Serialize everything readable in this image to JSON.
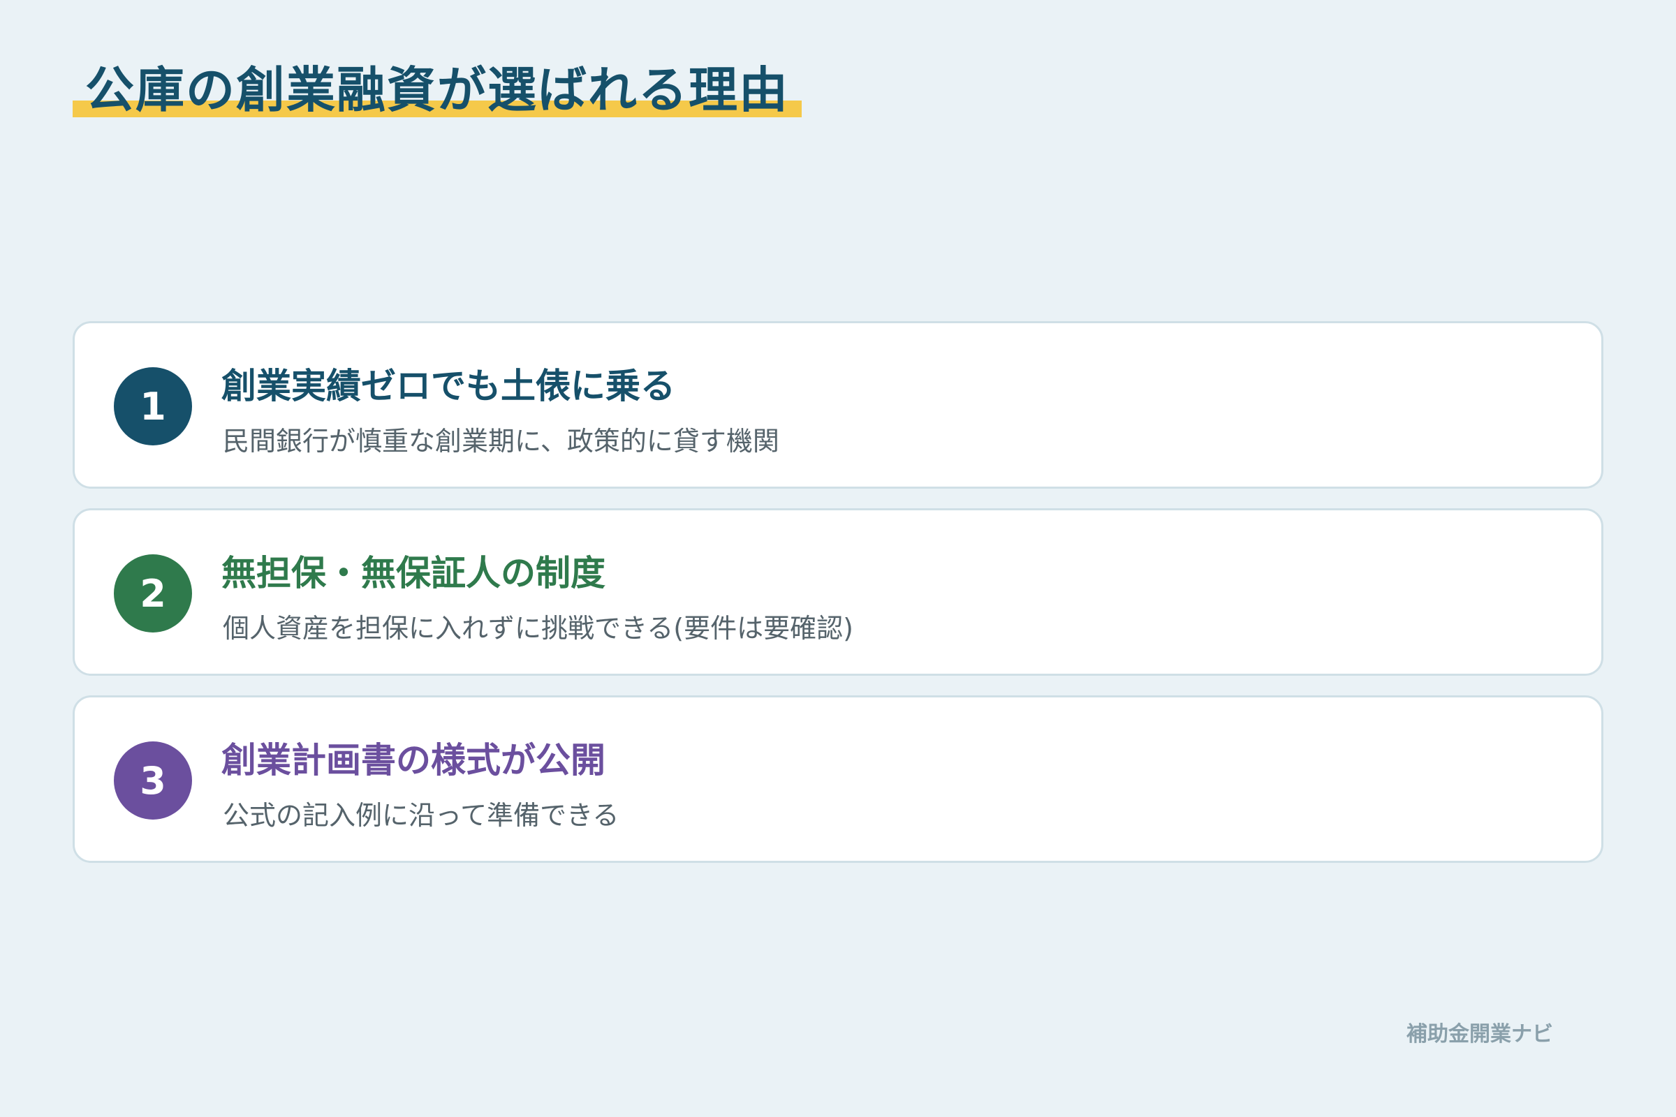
{
  "title": "公庫の創業融資が選ばれる理由",
  "colors": {
    "background": "#eaf2f6",
    "title": "#16506a",
    "highlight": "#f5c94a",
    "card_border": "#cfdfe6",
    "description": "#55636b",
    "footer": "#8aa0ab"
  },
  "reasons": [
    {
      "number": "1",
      "heading": "創業実績ゼロでも土俵に乗る",
      "description": "民間銀行が慎重な創業期に、政策的に貸す機関",
      "color": "#16506a"
    },
    {
      "number": "2",
      "heading": "無担保・無保証人の制度",
      "description": "個人資産を担保に入れずに挑戦できる(要件は要確認)",
      "color": "#2f7a4c"
    },
    {
      "number": "3",
      "heading": "創業計画書の様式が公開",
      "description": "公式の記入例に沿って準備できる",
      "color": "#6b4f9e"
    }
  ],
  "footer": "補助金開業ナビ"
}
